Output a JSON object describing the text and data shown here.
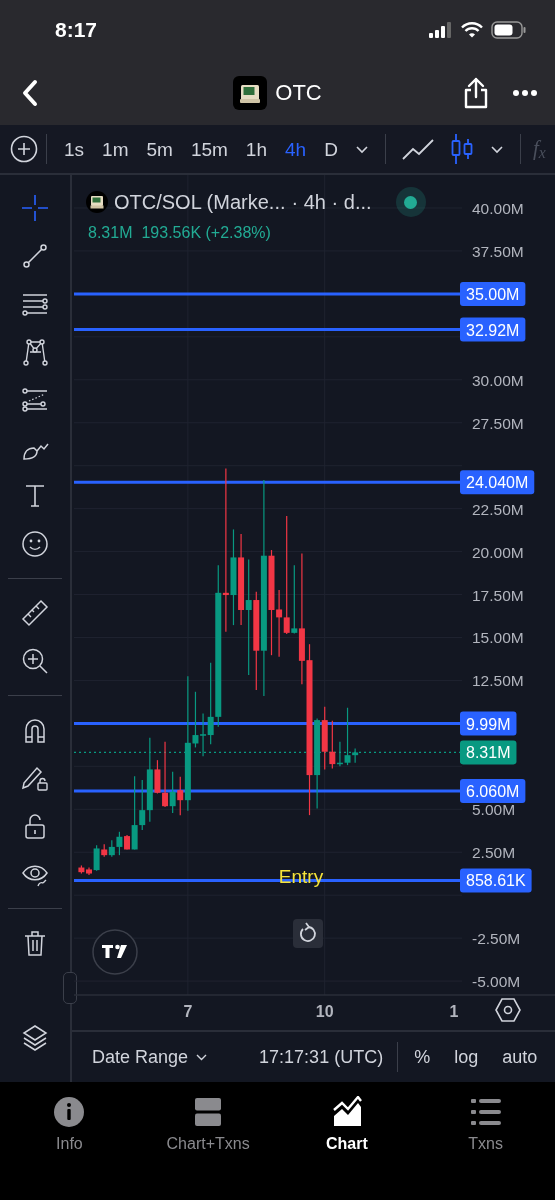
{
  "status_bar": {
    "time": "8:17"
  },
  "header": {
    "title": "OTC"
  },
  "toolbar": {
    "timeframes": [
      {
        "label": "1s",
        "selected": false
      },
      {
        "label": "1m",
        "selected": false
      },
      {
        "label": "5m",
        "selected": false
      },
      {
        "label": "15m",
        "selected": false
      },
      {
        "label": "1h",
        "selected": false
      },
      {
        "label": "4h",
        "selected": true
      },
      {
        "label": "D",
        "selected": false
      }
    ],
    "chart_types": [
      {
        "kind": "line",
        "selected": false
      },
      {
        "kind": "candles",
        "selected": true
      }
    ],
    "indicators_label": "f$_{x}$"
  },
  "tool_groups": [
    {
      "tools": [
        {
          "kind": "crosshair",
          "selected": true
        },
        {
          "kind": "trend-line",
          "selected": false
        },
        {
          "kind": "fib",
          "selected": false
        },
        {
          "kind": "pattern",
          "selected": false
        },
        {
          "kind": "measure",
          "selected": false
        },
        {
          "kind": "brush",
          "selected": false
        },
        {
          "kind": "text",
          "selected": false
        },
        {
          "kind": "emoji",
          "selected": false
        }
      ]
    },
    {
      "tools": [
        {
          "kind": "ruler",
          "selected": false
        },
        {
          "kind": "zoom",
          "selected": false
        }
      ]
    },
    {
      "tools": [
        {
          "kind": "magnet",
          "selected": false
        },
        {
          "kind": "lock-drawing",
          "selected": false
        },
        {
          "kind": "lock",
          "selected": false
        },
        {
          "kind": "eye",
          "selected": false
        }
      ]
    },
    {
      "tools": [
        {
          "kind": "trash",
          "selected": false
        }
      ]
    },
    {
      "tools": [
        {
          "kind": "layers",
          "selected": false
        }
      ]
    }
  ],
  "chart": {
    "legend": {
      "symbol": "OTC/SOL (Marke...",
      "details": "· 4h · d...",
      "live": true,
      "price": "8.31M",
      "change": "193.56K (+2.38%)"
    },
    "chart_data": {
      "type": "candlestick",
      "categories": [
        null,
        null,
        null,
        null,
        null,
        null,
        null,
        null,
        null,
        null,
        null,
        null,
        null,
        null,
        "7",
        null,
        null,
        null,
        null,
        null,
        null,
        null,
        null,
        null,
        null,
        null,
        null,
        null,
        null,
        null,
        null,
        null,
        "10",
        null,
        null,
        null,
        null,
        null,
        null,
        null,
        null,
        null,
        null,
        null,
        null,
        null,
        null,
        null,
        null,
        "1"
      ],
      "ohlc": [
        [
          1.61,
          1.73,
          1.26,
          1.34
        ],
        [
          1.5,
          1.61,
          1.18,
          1.26
        ],
        [
          1.46,
          2.91,
          1.42,
          2.72
        ],
        [
          2.66,
          2.97,
          2.23,
          2.33
        ],
        [
          2.33,
          3.2,
          2.23,
          2.81
        ],
        [
          2.81,
          3.69,
          2.33,
          3.4
        ],
        [
          3.44,
          3.5,
          2.66,
          2.66
        ],
        [
          2.66,
          6.93,
          2.66,
          4.08
        ],
        [
          4.08,
          6.7,
          3.79,
          4.95
        ],
        [
          4.95,
          9.16,
          4.27,
          7.32
        ],
        [
          7.32,
          7.86,
          5.92,
          5.96
        ],
        [
          5.96,
          8.93,
          5.14,
          5.18
        ],
        [
          5.18,
          7.18,
          4.79,
          6.02
        ],
        [
          6.11,
          6.89,
          4.66,
          5.53
        ],
        [
          5.53,
          12.75,
          4.91,
          8.87
        ],
        [
          8.83,
          11.84,
          8.6,
          9.32
        ],
        [
          9.28,
          10.58,
          8.09,
          9.37
        ],
        [
          9.32,
          13.53,
          8.79,
          10.38
        ],
        [
          10.38,
          19.21,
          9.8,
          17.6
        ],
        [
          17.6,
          24.84,
          15.33,
          17.47
        ],
        [
          17.47,
          21.29,
          15.72,
          19.66
        ],
        [
          19.66,
          21.02,
          15.72,
          16.6
        ],
        [
          16.6,
          19.54,
          12.81,
          17.18
        ],
        [
          17.18,
          17.66,
          11.94,
          14.23
        ],
        [
          14.23,
          24.16,
          11.59,
          19.76
        ],
        [
          19.76,
          20.09,
          13.97,
          16.6
        ],
        [
          16.63,
          17.76,
          13.88,
          16.17
        ],
        [
          16.17,
          22.07,
          15.2,
          15.27
        ],
        [
          15.27,
          19.21,
          15.23,
          15.53
        ],
        [
          15.53,
          19.89,
          12.28,
          13.64
        ],
        [
          13.68,
          14.61,
          4.66,
          6.99
        ],
        [
          6.99,
          10.29,
          5.05,
          10.19
        ],
        [
          10.19,
          10.97,
          7.32,
          8.35
        ],
        [
          8.35,
          10.15,
          7.37,
          7.63
        ],
        [
          7.63,
          8.93,
          7.51,
          7.71
        ],
        [
          7.71,
          10.91,
          7.57,
          8.15
        ],
        [
          8.15,
          8.54,
          7.71,
          8.31
        ],
        null,
        null,
        null,
        null,
        null,
        null,
        null,
        null,
        null,
        null,
        null,
        null,
        null
      ],
      "ylim": [
        -5.81,
        41.92
      ],
      "grid": true,
      "ref_lines": [
        {
          "axis": "y",
          "value": 35.0,
          "label": "35.00M",
          "color": "#2962ff"
        },
        {
          "axis": "y",
          "value": 32.92,
          "label": "32.92M",
          "color": "#2962ff"
        },
        {
          "axis": "y",
          "value": 24.04,
          "label": "24.040M",
          "color": "#2962ff"
        },
        {
          "axis": "y",
          "value": 9.99,
          "label": "9.99M",
          "color": "#2962ff"
        },
        {
          "axis": "y",
          "value": 8.31,
          "label": "8.31M",
          "color": "#089981"
        },
        {
          "axis": "y",
          "value": 6.06,
          "label": "6.060M",
          "color": "#2962ff"
        },
        {
          "axis": "y",
          "value": 0.85861,
          "label": "858.61K",
          "color": "#2962ff"
        }
      ],
      "annotations": [
        "Entry"
      ],
      "yticks": [
        {
          "value": 40,
          "label": "40.00M"
        },
        {
          "value": 37.5,
          "label": "37.50M"
        },
        {
          "value": 30,
          "label": "30.00M"
        },
        {
          "value": 27.5,
          "label": "27.50M"
        },
        {
          "value": 22.5,
          "label": "22.50M"
        },
        {
          "value": 20,
          "label": "20.00M"
        },
        {
          "value": 17.5,
          "label": "17.50M"
        },
        {
          "value": 15,
          "label": "15.00M"
        },
        {
          "value": 12.5,
          "label": "12.50M"
        },
        {
          "value": 5,
          "label": "5.00M"
        },
        {
          "value": 2.5,
          "label": "2.50M"
        },
        {
          "value": -2.5,
          "label": "-2.50M"
        },
        {
          "value": -5,
          "label": "-5.00M"
        }
      ]
    }
  },
  "bottom_bar": {
    "date_range": "Date Range",
    "time": "17:17:31 (UTC)",
    "scale_options": [
      "%",
      "log",
      "auto"
    ]
  },
  "tabs": [
    {
      "label": "Info",
      "kind": "info",
      "selected": false
    },
    {
      "label": "Chart+Txns",
      "kind": "split",
      "selected": false
    },
    {
      "label": "Chart",
      "kind": "chart",
      "selected": true
    },
    {
      "label": "Txns",
      "kind": "list",
      "selected": false
    }
  ]
}
